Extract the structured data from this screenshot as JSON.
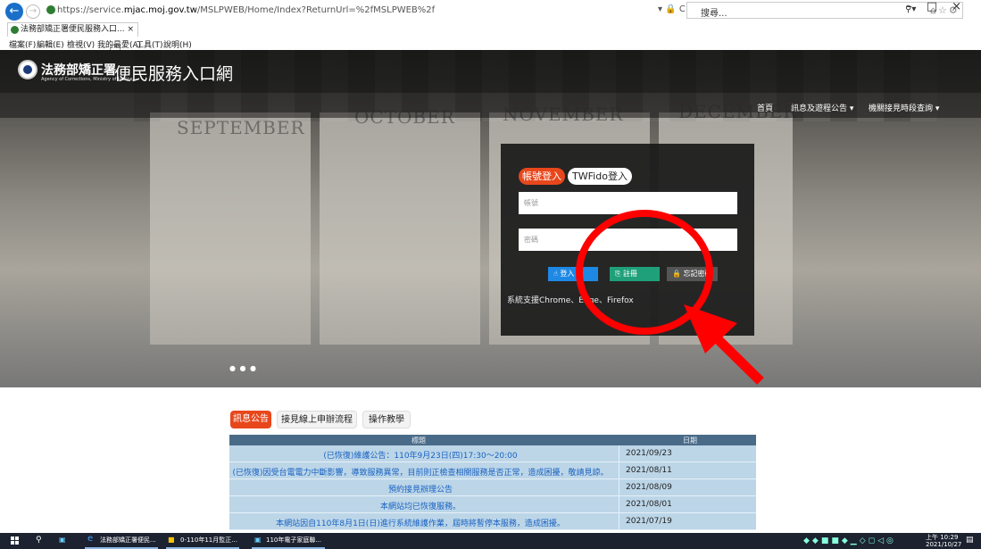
{
  "browser": {
    "url_prefix": "https://service.",
    "url_domain": "mjac.moj.gov.tw",
    "url_path": "/MSLPWEB/Home/Index?ReturnUrl=%2fMSLPWEB%2f",
    "addr_tools": "▾ 🔒 C",
    "search_placeholder": "搜尋...",
    "tab_title": "法務部矯正署便民服務入口...",
    "menu": [
      "檔案(F)",
      "編輯(E)",
      "檢視(V)",
      "我的最愛(A)",
      "工具(T)",
      "說明(H)"
    ]
  },
  "header": {
    "logo_cn": "法務部矯正署",
    "logo_en": "Agency of Corrections, Ministry of Justice",
    "site_title": "便民服務入口網",
    "nav": [
      "首頁",
      "訊息及遊程公告 ▾",
      "機關接見時段查詢 ▾"
    ]
  },
  "hero_months": [
    "SEPTEMBER",
    "OCTOBER",
    "NOVEMBER",
    "DECEMBER"
  ],
  "login": {
    "tab_active": "帳號登入",
    "tab_other": "TWFido登入",
    "username_placeholder": "帳號",
    "password_placeholder": "密碼",
    "btn_login": "登入",
    "btn_register": "註冊",
    "btn_forgot": "忘記密碼",
    "note": "系統支援Chrome、Edge、Firefox"
  },
  "content_tabs": [
    "訊息公告",
    "接見線上申辦流程",
    "操作教學"
  ],
  "news": {
    "col_title": "標題",
    "col_date": "日期",
    "rows": [
      {
        "title": "(已恢復)維護公告：110年9月23日(四)17:30～20:00",
        "date": "2021/09/23"
      },
      {
        "title": "(已恢復)因受台電電力中斷影響，導致服務異常，目前則正檢查相關服務是否正常，造成困擾，敬請見諒。",
        "date": "2021/08/11"
      },
      {
        "title": "預約接見辦理公告",
        "date": "2021/08/09"
      },
      {
        "title": "本網站均已恢復服務。",
        "date": "2021/08/01"
      },
      {
        "title": "本網站因自110年8月1日(日)進行系統維護作業，屆時將暫停本服務，造成困擾。",
        "date": "2021/07/19"
      }
    ]
  },
  "taskbar": {
    "items": [
      "法務部矯正署便民...",
      "0-110年11月監正...",
      "110年電子家庭聯..."
    ],
    "time": "上午 10:29",
    "date": "2021/10/27"
  },
  "colors": {
    "accent_orange": "#e8471c",
    "annotation_red": "#ff0000",
    "table_header": "#4a6b88",
    "table_row": "#bcd6e8"
  }
}
